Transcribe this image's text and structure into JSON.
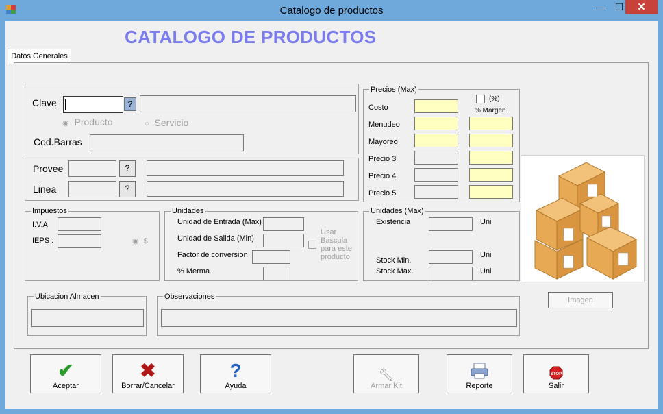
{
  "window": {
    "title": "Catalogo de productos",
    "close": "✕",
    "maximize": "☐",
    "minimize": "—"
  },
  "header": {
    "title": "CATALOGO DE PRODUCTOS"
  },
  "tabs": [
    {
      "label": "Datos Generales"
    }
  ],
  "clave": {
    "label": "Clave",
    "help": "?",
    "value": "",
    "desc": ""
  },
  "tipo": {
    "producto": "Producto",
    "servicio": "Servicio"
  },
  "codbarras": {
    "label": "Cod.Barras",
    "value": ""
  },
  "provee": {
    "label": "Provee",
    "help": "?"
  },
  "linea": {
    "label": "Linea",
    "help": "?"
  },
  "precios": {
    "title": "Precios (Max)",
    "pct": "(%)",
    "margen": "% Margen",
    "rows": [
      "Costo",
      "Menudeo",
      "Mayoreo",
      "Precio 3",
      "Precio 4",
      "Precio 5"
    ]
  },
  "impuestos": {
    "title": "Impuestos",
    "iva": "I.V.A",
    "ieps": "IEPS :",
    "dollar": "$"
  },
  "unidades": {
    "title": "Unidades",
    "entrada": "Unidad de Entrada (Max)",
    "salida": "Unidad de Salida (Min)",
    "factor": "Factor de conversion",
    "merma": "% Merma",
    "bascula": "Usar Bascula para este producto"
  },
  "unidadesmax": {
    "title": "Unidades (Max)",
    "existencia": "Existencia",
    "stockmin": "Stock Min.",
    "stockmax": "Stock Max.",
    "uni": "Uni"
  },
  "ubicacion": {
    "title": "Ubicacion Almacen"
  },
  "observaciones": {
    "title": "Observaciones"
  },
  "imagen": {
    "button": "Imagen",
    "icon": "boxes-image"
  },
  "buttons": {
    "aceptar": "Aceptar",
    "borrar": "Borrar/Cancelar",
    "ayuda": "Ayuda",
    "armar": "Armar Kit",
    "reporte": "Reporte",
    "salir": "Salir"
  },
  "colors": {
    "window": "#6fa9dc",
    "title": "#7b7bf0",
    "yellow": "#ffffc0",
    "close": "#c7423b"
  }
}
